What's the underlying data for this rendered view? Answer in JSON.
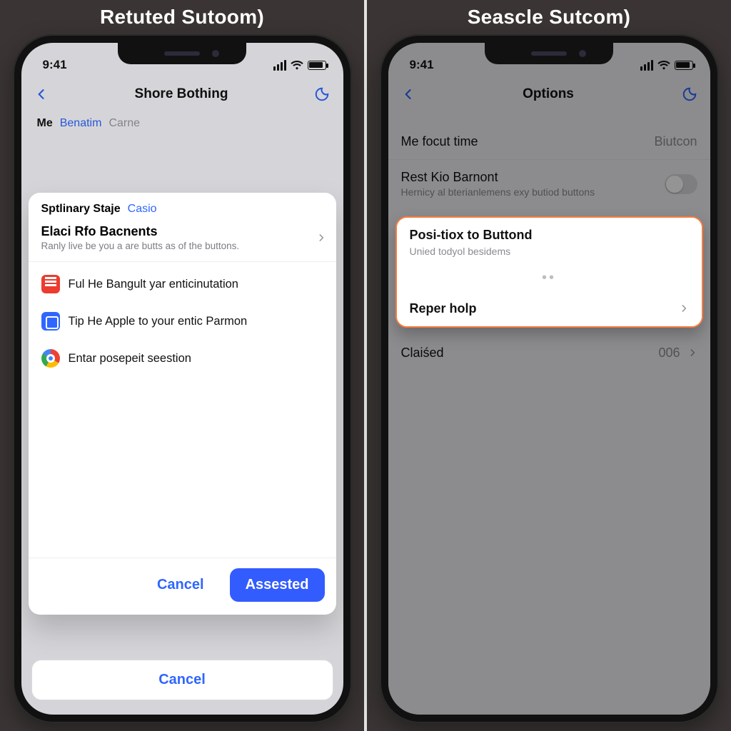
{
  "left": {
    "caption": "Retuted Sutoom)",
    "status": {
      "time": "9:41"
    },
    "nav": {
      "title": "Shore Bothing"
    },
    "peek": {
      "label_strong": "Me",
      "label_accent": "Benatim",
      "label_muted": "Carne"
    },
    "sheet": {
      "header_label": "Sptlinary Staje",
      "header_accent": "Casio",
      "lead_title": "Elaci Rfo Bacnents",
      "lead_sub": "Ranly live be you a are butts as of the buttons.",
      "options": [
        {
          "icon": "ic-red",
          "text": "Ful He Bangult yar enticinutation"
        },
        {
          "icon": "ic-blue",
          "text": "Tip He Apple to your entic Parmon"
        },
        {
          "icon": "ic-chrome",
          "text": "Entar posepeit seestion"
        }
      ],
      "cancel": "Cancel",
      "confirm": "Assested"
    },
    "bottom_cancel": "Cancel"
  },
  "right": {
    "caption": "Seascle Sutcom)",
    "status": {
      "time": "9:41"
    },
    "nav": {
      "title": "Options"
    },
    "rowA": {
      "label": "Me focut time",
      "value": "Biutcon"
    },
    "rowB": {
      "label": "Rest Kio Barnont",
      "sub": "Hernicy al bterianlemens exy butiod buttons"
    },
    "highlight": {
      "title": "Posi-tiox to Buttond",
      "sub": "Unied todyol besidems",
      "help": "Reper holp"
    },
    "rowC": {
      "label": "Claiśed",
      "value": "006"
    }
  }
}
